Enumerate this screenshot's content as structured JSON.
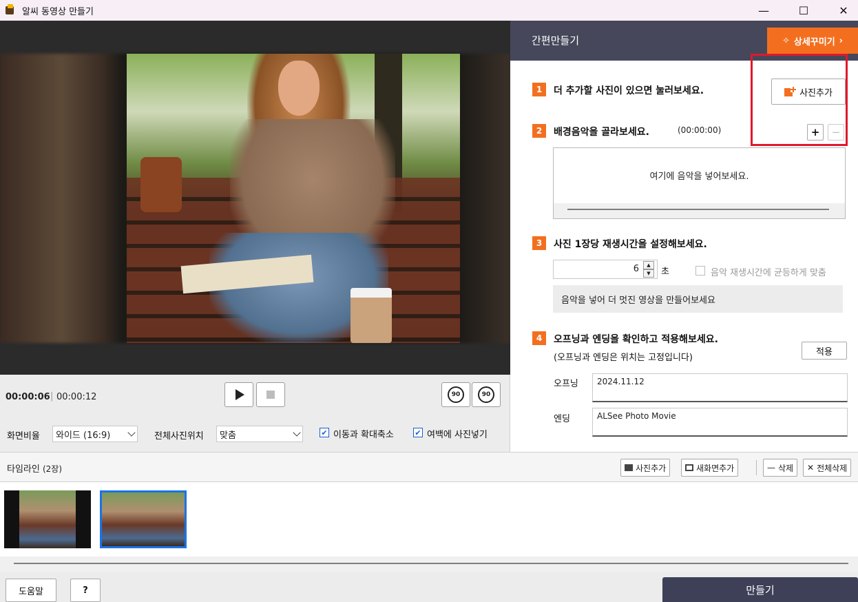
{
  "window": {
    "title": "알씨 동영상 만들기",
    "minimize_glyph": "—",
    "maximize_glyph": "☐",
    "close_glyph": "✕"
  },
  "player": {
    "current_time": "00:00:06",
    "total_time": "00:00:12",
    "rotate_left_label": "90",
    "rotate_right_label": "90"
  },
  "options": {
    "aspect_label": "화면비율",
    "aspect_value": "와이드 (16:9)",
    "position_label": "전체사진위치",
    "position_value": "맞춤",
    "pan_zoom_label": "이동과 확대축소",
    "pan_zoom_checked": true,
    "fill_margin_label": "여백에 사진넣기",
    "fill_margin_checked": true
  },
  "panel": {
    "title": "간편만들기",
    "detail_button": "상세꾸미기",
    "step1": {
      "num": "1",
      "text": "더 추가할 사진이 있으면 눌러보세요.",
      "button": "사진추가"
    },
    "step2": {
      "num": "2",
      "text": "배경음악을 골라보세요.",
      "duration": "(00:00:00)",
      "add": "+",
      "remove": "−",
      "hint": "여기에 음악을 넣어보세요."
    },
    "step3": {
      "num": "3",
      "text": "사진 1장당 재생시간을 설정해보세요.",
      "seconds_value": "6",
      "unit": "초",
      "even_label": "음악 재생시간에 균등하게 맞춤",
      "notice": "음악을 넣어 더 멋진 영상을 만들어보세요"
    },
    "step4": {
      "num": "4",
      "text": "오프닝과 엔딩을 확인하고 적용해보세요.",
      "sub": "(오프닝과 엔딩은 위치는 고정입니다)",
      "apply": "적용",
      "opening_label": "오프닝",
      "opening_value": "2024.11.12",
      "ending_label": "엔딩",
      "ending_value": "ALSee Photo Movie"
    }
  },
  "timeline": {
    "title": "타임라인",
    "count": "(2장)",
    "add_photo": "사진추가",
    "add_screen": "새화면추가",
    "delete": "삭제",
    "delete_all": "전체삭제"
  },
  "footer": {
    "help": "도움말",
    "question": "?",
    "make": "만들기"
  },
  "colors": {
    "accent": "#f36f1f",
    "header": "#46475a",
    "make_button": "#3e4058",
    "selection": "#1a73e8",
    "highlight_box": "#e0182d"
  }
}
